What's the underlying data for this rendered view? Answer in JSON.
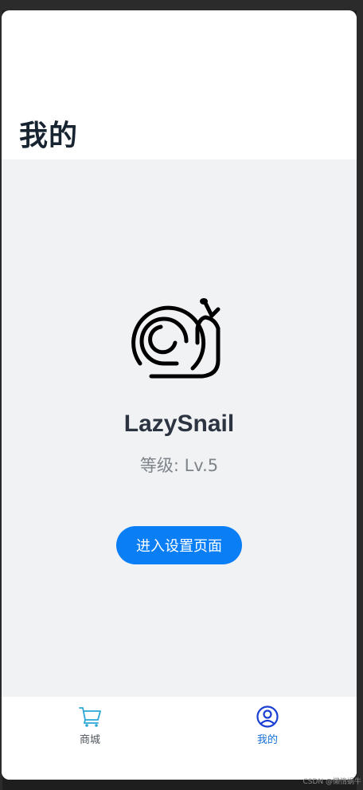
{
  "header": {
    "title": "我的"
  },
  "profile": {
    "avatar_icon": "snail-icon",
    "username": "LazySnail",
    "level": "等级: Lv.5",
    "settings_button": "进入设置页面"
  },
  "tabbar": {
    "items": [
      {
        "label": "商城",
        "icon": "cart-icon",
        "selected": false
      },
      {
        "label": "我的",
        "icon": "user-circle-icon",
        "selected": true
      }
    ]
  },
  "colors": {
    "accent": "#0a7ff5",
    "selected_tab": "#1670d8",
    "content_bg": "#f0f2f4",
    "cart_icon": "#2aa7d6"
  },
  "watermark": "CSDN @懒惰蜗牛"
}
